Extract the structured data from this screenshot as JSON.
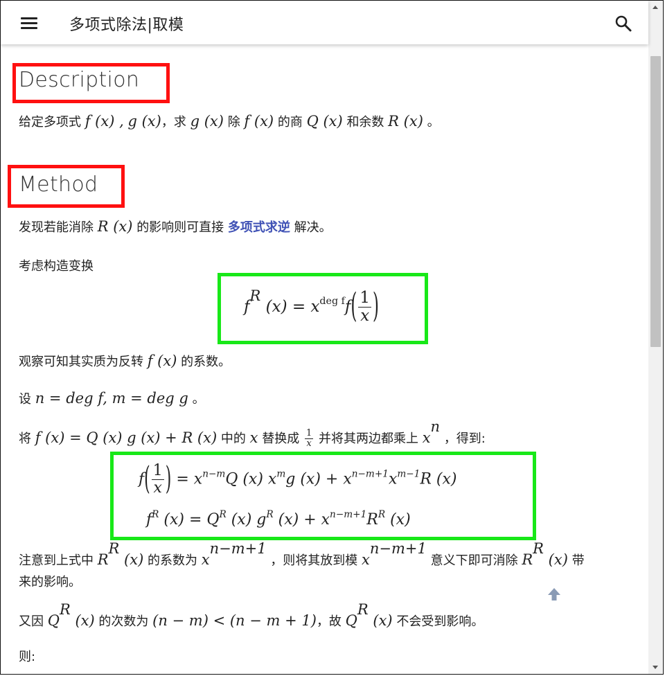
{
  "header": {
    "title": "多项式除法|取模",
    "menu_icon": "menu-icon",
    "search_icon": "search-icon"
  },
  "sections": {
    "description": {
      "heading": "Description",
      "text_prefix": "给定多项式",
      "math_fx": "f (x) ,",
      "math_gx": "g (x)",
      "text_mid1": "，求",
      "math_gx2": "g (x)",
      "text_mid2": "除",
      "math_fx2": "f (x)",
      "text_mid3": "的商",
      "math_qx": "Q (x)",
      "text_mid4": "和余数",
      "math_rx": "R (x)",
      "text_end": "。"
    },
    "method": {
      "heading": "Method",
      "p1_prefix": "发现若能消除",
      "p1_math": "R (x)",
      "p1_mid": "的影响则可直接",
      "p1_link": "多项式求逆",
      "p1_end": "解决。",
      "p2": "考虑构造变换",
      "eq1_lhs": "f",
      "eq1_sup": "R",
      "eq1_arg": " (x) = x",
      "eq1_deg": "deg f",
      "eq1_f": "f",
      "eq1_num": "1",
      "eq1_den": "x",
      "p3_prefix": "观察可知其实质为反转",
      "p3_math": "f (x)",
      "p3_end": "的系数。",
      "p4_prefix": "设",
      "p4_math": "n = deg f, m = deg g",
      "p4_end": "。",
      "p5_prefix": "将",
      "p5_math": "f (x) = Q (x) g (x) + R (x)",
      "p5_mid": "中的",
      "p5_x": "x",
      "p5_mid2": "替换成",
      "p5_num": "1",
      "p5_den": "x",
      "p5_mid3": "并将其两边都乘上",
      "p5_xn": "x",
      "p5_n": "n",
      "p5_end": "，得到:",
      "eq2_line1_rhs": "= x",
      "eq2_l1_sup1": "n−m",
      "eq2_l1_t1": "Q (x) x",
      "eq2_l1_sup2": "m",
      "eq2_l1_t2": "g (x) + x",
      "eq2_l1_sup3": "n−m+1",
      "eq2_l1_t3": "x",
      "eq2_l1_sup4": "m−1",
      "eq2_l1_t4": "R (x)",
      "eq2_line2": "(x) = Q",
      "eq2_l2_t2": "(x) g",
      "eq2_l2_t3": "(x) + x",
      "eq2_l2_sup": "n−m+1",
      "eq2_l2_t4": "R",
      "eq2_l2_t5": "(x)",
      "p6_prefix": "注意到上式中",
      "p6_math": "R",
      "p6_math2": " (x)",
      "p6_mid": "的系数为",
      "p6_sup": "n−m+1",
      "p6_mid2": "，则将其放到模",
      "p6_mid3": "意义下即可消除",
      "p6_end": "带",
      "p6_line2": "来的影响。",
      "p7_prefix": "又因",
      "p7_math_q": "Q",
      "p7_mid": "的次数为",
      "p7_ineq": "(n − m) < (n − m + 1)",
      "p7_mid2": "，故",
      "p7_end": "不会受到影响。",
      "p8": "则:",
      "sup_R": "R"
    }
  },
  "colors": {
    "highlight_red": "#ff1010",
    "highlight_green": "#18e818",
    "link": "#3f51b5"
  }
}
